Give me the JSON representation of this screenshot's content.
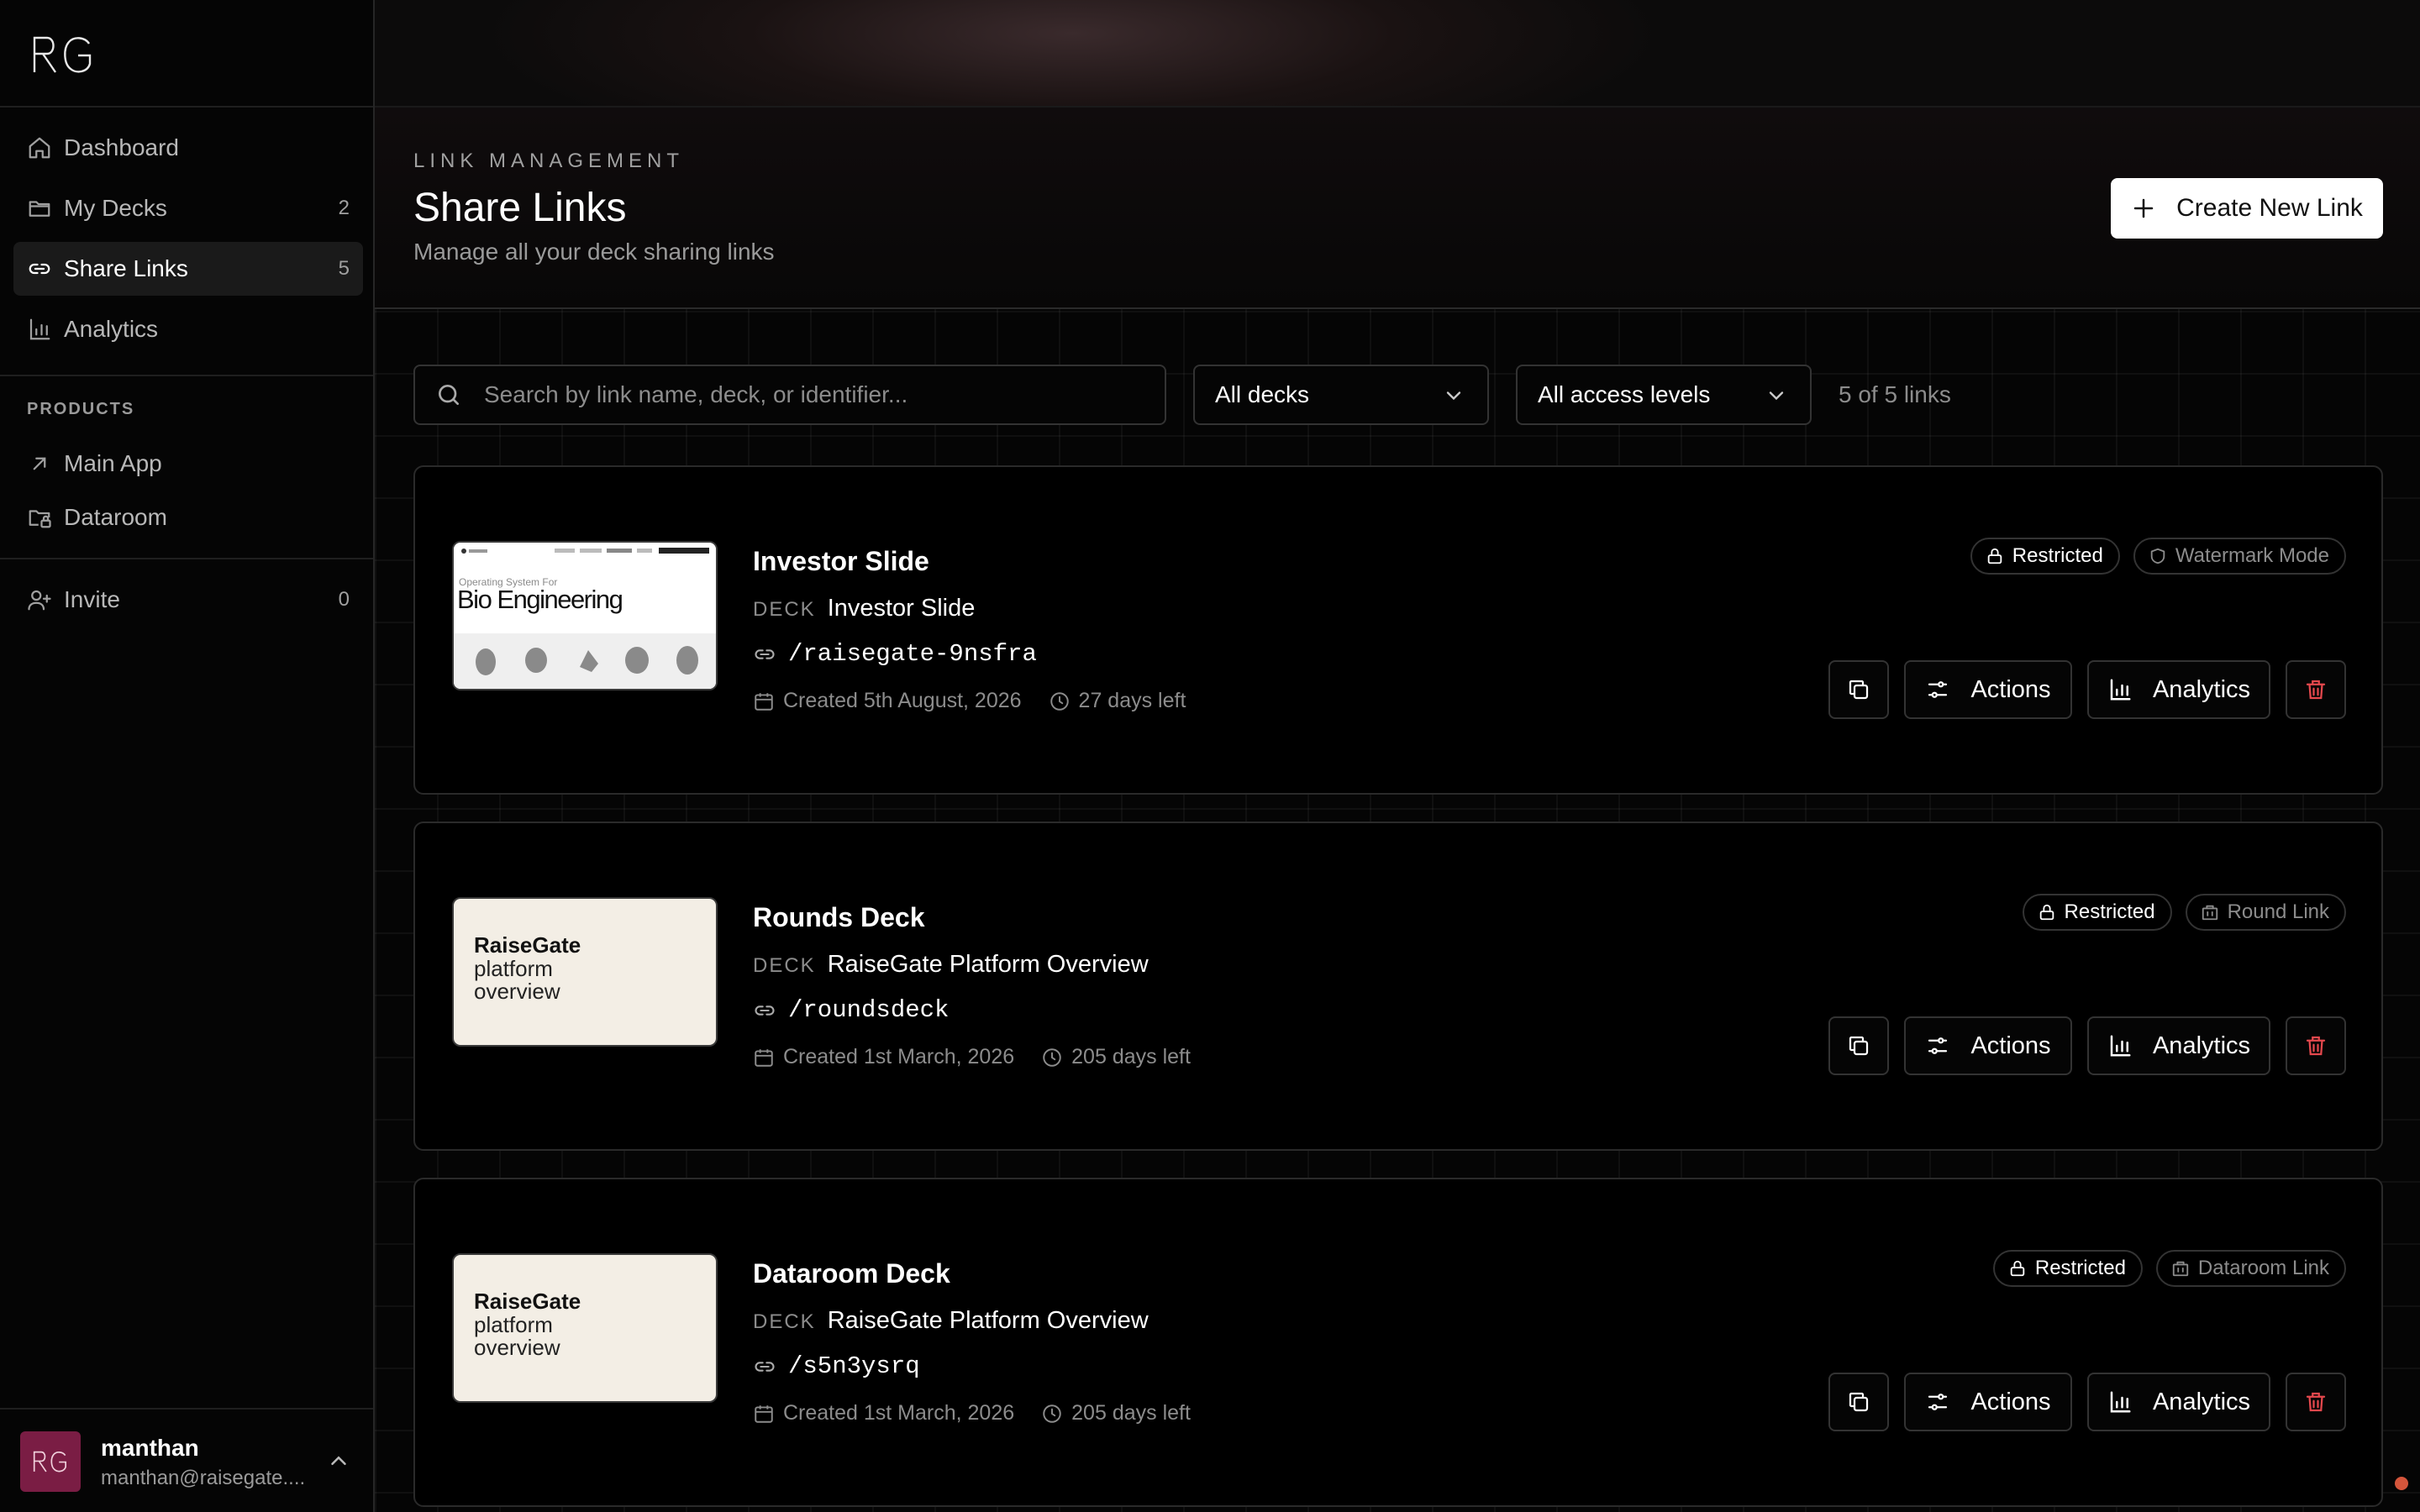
{
  "sidebar": {
    "nav": [
      {
        "label": "Dashboard",
        "icon": "home-icon"
      },
      {
        "label": "My Decks",
        "count": "2",
        "icon": "folder-icon"
      },
      {
        "label": "Share Links",
        "count": "5",
        "icon": "link-icon"
      },
      {
        "label": "Analytics",
        "icon": "chart-icon"
      }
    ],
    "products_label": "PRODUCTS",
    "products": [
      {
        "label": "Main App",
        "icon": "arrow-up-right-icon"
      },
      {
        "label": "Dataroom",
        "icon": "folder-lock-icon"
      }
    ],
    "invite": {
      "label": "Invite",
      "count": "0",
      "icon": "user-plus-icon"
    },
    "user": {
      "name": "manthan",
      "email": "manthan@raisegate...."
    }
  },
  "header": {
    "eyebrow": "LINK MANAGEMENT",
    "title": "Share Links",
    "subtitle": "Manage all your deck sharing links",
    "create_label": "Create New Link"
  },
  "filters": {
    "search_placeholder": "Search by link name, deck, or identifier...",
    "deck_select": "All decks",
    "access_select": "All access levels",
    "count_text": "5 of 5 links"
  },
  "labels": {
    "deck": "DECK",
    "actions": "Actions",
    "analytics": "Analytics"
  },
  "links": [
    {
      "name": "Investor Slide",
      "deck": "Investor Slide",
      "slug": "/raisegate-9nsfra",
      "created": "Created 5th August, 2026",
      "remaining": "27 days left",
      "access": "Restricted",
      "mode": "Watermark Mode",
      "thumb": {
        "kind": "white",
        "small": "Operating System For",
        "big": "Bio Engineering"
      }
    },
    {
      "name": "Rounds Deck",
      "deck": "RaiseGate Platform Overview",
      "slug": "/roundsdeck",
      "created": "Created 1st March, 2026",
      "remaining": "205 days left",
      "access": "Restricted",
      "mode": "Round Link",
      "thumb": {
        "kind": "cream",
        "line1": "RaiseGate",
        "line2": "platform",
        "line3": "overview"
      }
    },
    {
      "name": "Dataroom Deck",
      "deck": "RaiseGate Platform Overview",
      "slug": "/s5n3ysrq",
      "created": "Created 1st March, 2026",
      "remaining": "205 days left",
      "access": "Restricted",
      "mode": "Dataroom Link",
      "thumb": {
        "kind": "cream",
        "line1": "RaiseGate",
        "line2": "platform",
        "line3": "overview"
      }
    }
  ],
  "colors": {
    "accent_avatar": "#7a1d44",
    "danger": "#e5484d",
    "background": "#050505",
    "border": "#333333"
  }
}
